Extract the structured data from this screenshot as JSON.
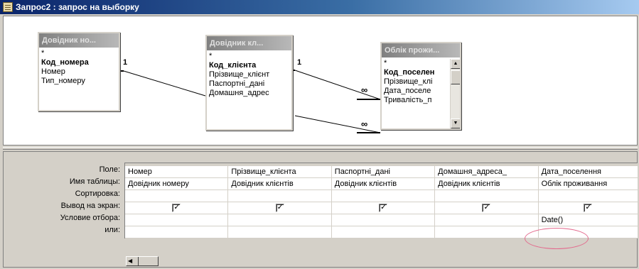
{
  "window": {
    "title": "Запрос2 : запрос на выборку"
  },
  "tables": [
    {
      "title": "Довідник но...",
      "fields": [
        "*",
        "Код_номера",
        "Номер",
        "Тип_номеру"
      ],
      "key_index": 1
    },
    {
      "title": "Довідник кл...",
      "fields": [
        "*",
        "Код_клієнта",
        "Прізвище_клієнт",
        "Паспортні_дані",
        "Домашня_адрес"
      ],
      "key_index": 1
    },
    {
      "title": "Облік прожи...",
      "fields": [
        "*",
        "Код_поселен",
        "Прізвище_клі",
        "Дата_поселе",
        "Тривалість_п"
      ],
      "key_index": 1
    }
  ],
  "joins": [
    {
      "from_label": "1",
      "to_label": "∞"
    },
    {
      "from_label": "1",
      "to_label": "∞"
    },
    {
      "to_label": "∞"
    }
  ],
  "grid": {
    "row_labels": [
      "Поле:",
      "Имя таблицы:",
      "Сортировка:",
      "Вывод на экран:",
      "Условие отбора:",
      "или:"
    ],
    "columns": [
      {
        "field": "Номер",
        "table": "Довідник номеру",
        "sort": "",
        "show": true,
        "criteria": "",
        "or": ""
      },
      {
        "field": "Прізвище_клієнта",
        "table": "Довідник клієнтів",
        "sort": "",
        "show": true,
        "criteria": "",
        "or": ""
      },
      {
        "field": "Паспортні_дані",
        "table": "Довідник клієнтів",
        "sort": "",
        "show": true,
        "criteria": "",
        "or": ""
      },
      {
        "field": "Домашня_адреса_",
        "table": "Довідник клієнтів",
        "sort": "",
        "show": true,
        "criteria": "",
        "or": ""
      },
      {
        "field": "Дата_поселення",
        "table": "Облік проживання",
        "sort": "",
        "show": true,
        "criteria": "Date()",
        "or": ""
      }
    ]
  },
  "icons": {
    "window_icon": "query-window-icon",
    "scroll_left": "scroll-left-arrow-icon",
    "scroll_up": "scroll-up-arrow-icon",
    "scroll_down": "scroll-down-arrow-icon",
    "checkmark": "checkmark-icon"
  },
  "colors": {
    "title_gradient_start": "#0a246a",
    "title_gradient_end": "#a6caf0",
    "highlight_oval": "#e36b8e"
  }
}
